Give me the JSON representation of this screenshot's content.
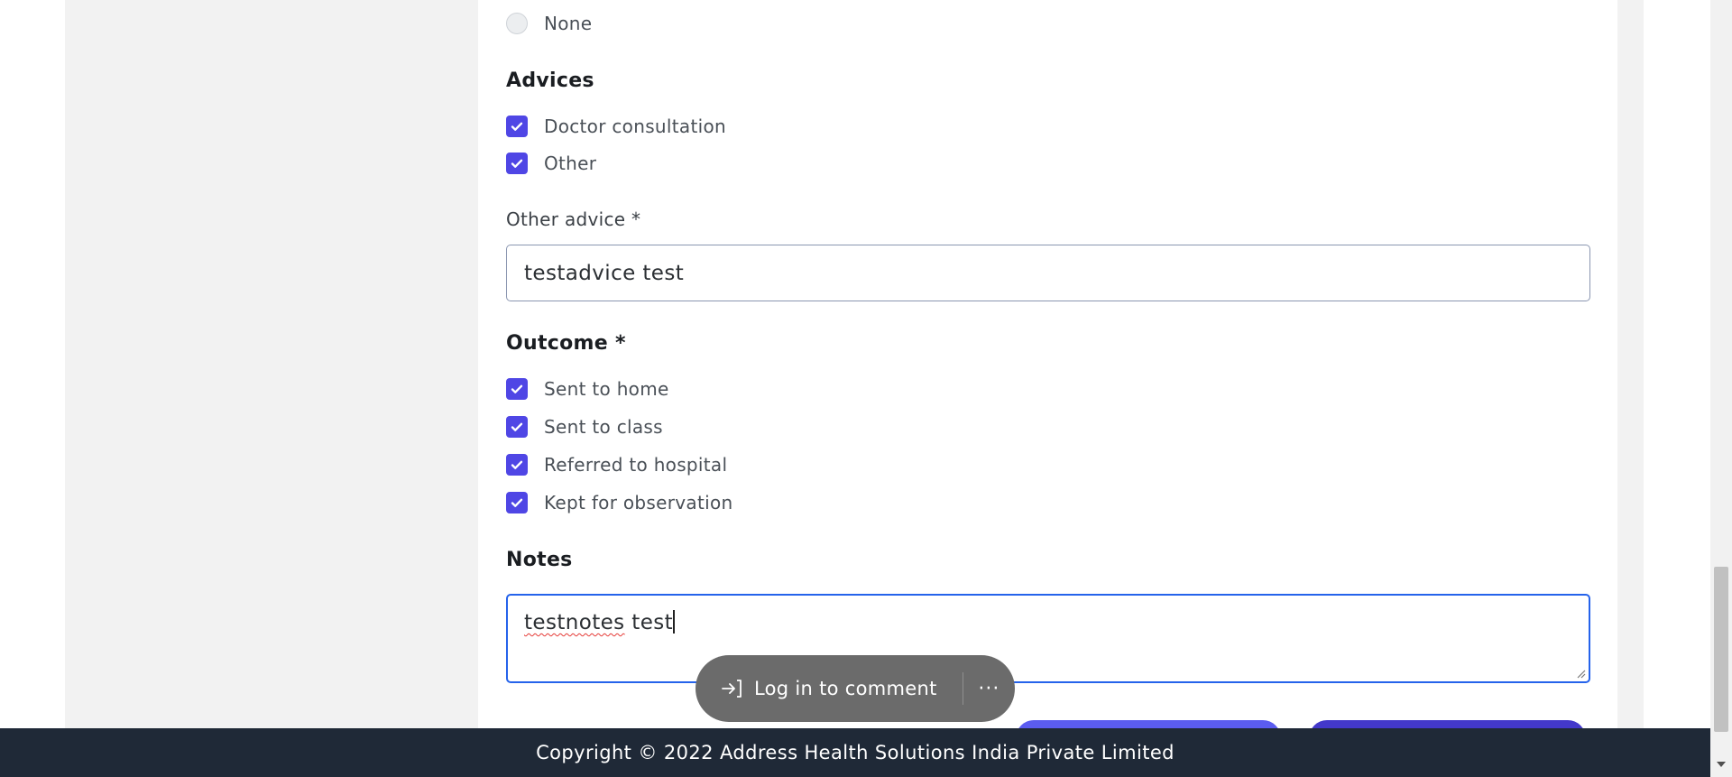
{
  "symptoms": {
    "none_label": "None"
  },
  "advices": {
    "title": "Advices",
    "items": [
      {
        "label": "Doctor consultation",
        "checked": true
      },
      {
        "label": "Other",
        "checked": true
      }
    ]
  },
  "other_advice": {
    "label": "Other advice *",
    "value": "testadvice test"
  },
  "outcome": {
    "title": "Outcome *",
    "items": [
      {
        "label": "Sent to home",
        "checked": true
      },
      {
        "label": "Sent to class",
        "checked": true
      },
      {
        "label": "Referred to hospital",
        "checked": true
      },
      {
        "label": "Kept for observation",
        "checked": true
      }
    ]
  },
  "notes": {
    "title": "Notes",
    "value_word1": "testnotes",
    "value_word2": "test"
  },
  "comment_bar": {
    "label": "Log in to comment",
    "more": "···"
  },
  "footer": {
    "text": "Copyright © 2022 Address Health Solutions India Private Limited"
  },
  "colors": {
    "accent": "#4f46e5",
    "focus": "#2563eb",
    "footer_bg": "#1f2937"
  }
}
